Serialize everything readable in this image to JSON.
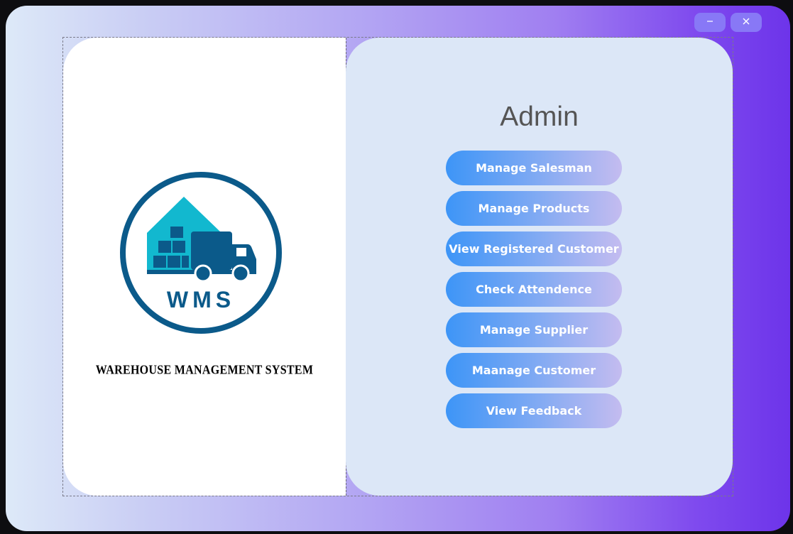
{
  "window": {
    "minimize_symbol": "–",
    "close_symbol": "✕"
  },
  "brand": {
    "logo_text": "WMS",
    "system_title": "WAREHOUSE MANAGEMENT SYSTEM"
  },
  "panel": {
    "title": "Admin",
    "buttons": [
      {
        "label": "Manage Salesman"
      },
      {
        "label": "Manage Products"
      },
      {
        "label": "View Registered Customer"
      },
      {
        "label": "Check Attendence"
      },
      {
        "label": "Manage Supplier"
      },
      {
        "label": "Maanage Customer"
      },
      {
        "label": "View Feedback"
      }
    ]
  },
  "colors": {
    "button_gradient_start": "#3d95f7",
    "button_gradient_end": "#c4bcf0",
    "logo_ring": "#0b5a8a",
    "logo_house": "#12b8cf",
    "right_panel_bg": "#dce7f7"
  }
}
